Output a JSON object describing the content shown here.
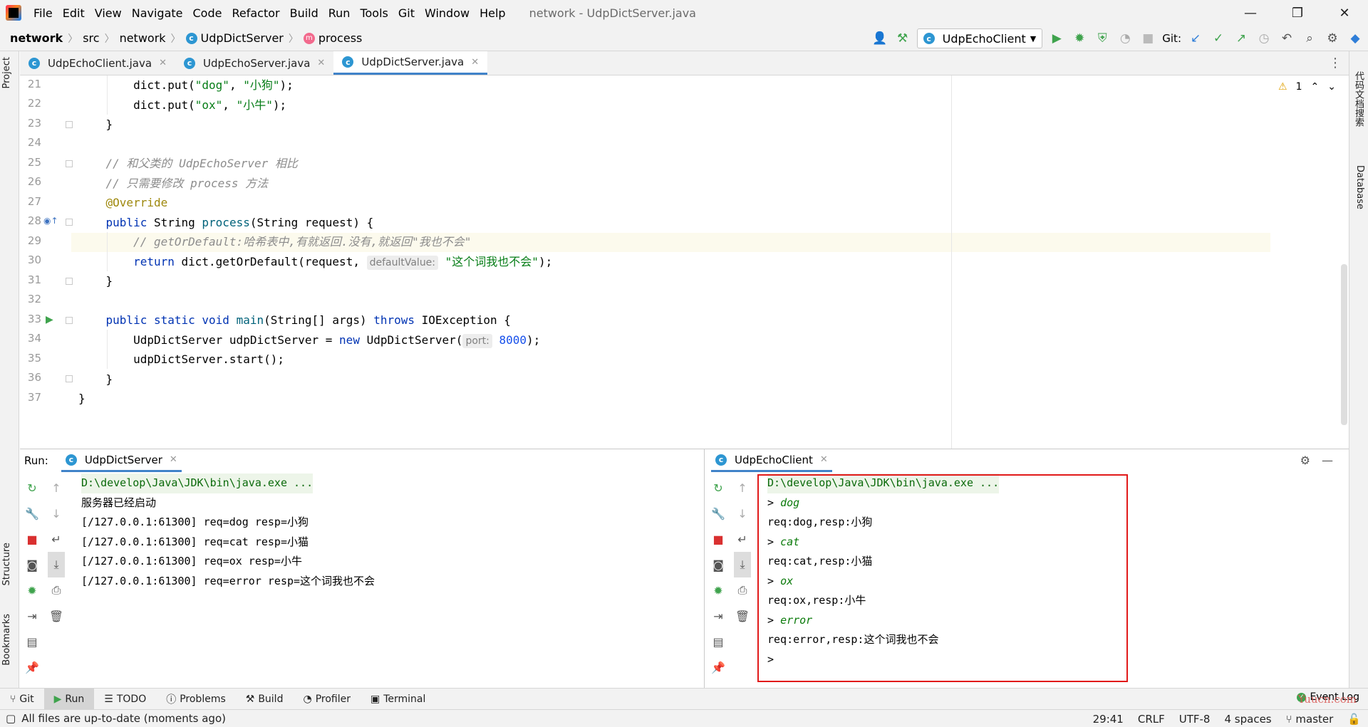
{
  "window": {
    "title": "network - UdpDictServer.java",
    "menu": [
      "File",
      "Edit",
      "View",
      "Navigate",
      "Code",
      "Refactor",
      "Build",
      "Run",
      "Tools",
      "Git",
      "Window",
      "Help"
    ]
  },
  "breadcrumb": [
    "network",
    "src",
    "network",
    "UdpDictServer",
    "process"
  ],
  "toolbar": {
    "run_config": "UdpEchoClient",
    "git_label": "Git:"
  },
  "left_strip": {
    "project": "Project",
    "structure": "Structure",
    "bookmarks": "Bookmarks"
  },
  "right_strip": {
    "code_search": "代码文档搜索",
    "database": "Database"
  },
  "tabs": [
    {
      "label": "UdpEchoClient.java",
      "active": false
    },
    {
      "label": "UdpEchoServer.java",
      "active": false
    },
    {
      "label": "UdpDictServer.java",
      "active": true
    }
  ],
  "editor": {
    "warning_count": "1",
    "line_numbers": [
      "21",
      "22",
      "23",
      "24",
      "25",
      "26",
      "27",
      "28",
      "29",
      "30",
      "31",
      "32",
      "33",
      "34",
      "35",
      "36",
      "37"
    ],
    "lines": {
      "l21": {
        "a": "        dict.put(",
        "s1": "\"dog\"",
        "b": ", ",
        "s2": "\"小狗\"",
        "c": ");"
      },
      "l22": {
        "a": "        dict.put(",
        "s1": "\"ox\"",
        "b": ", ",
        "s2": "\"小牛\"",
        "c": ");"
      },
      "l23": "    }",
      "l25": "    // 和父类的 UdpEchoServer 相比",
      "l26": "    // 只需要修改 process 方法",
      "l27": "    @Override",
      "l28": {
        "kw": "    public ",
        "type": "String ",
        "name": "process",
        "args": "(String request) {"
      },
      "l29": "        // getOrDefault:哈希表中,有就返回.没有,就返回\"我也不会\"",
      "l30": {
        "kw": "        return ",
        "a": "dict.getOrDefault(request, ",
        "hint": "defaultValue:",
        "s": "\"这个词我也不会\"",
        "c": ");"
      },
      "l31": "    }",
      "l33": {
        "kw": "    public static void ",
        "name": "main",
        "a": "(String[] args) ",
        "kw2": "throws ",
        "b": "IOException {"
      },
      "l34": {
        "a": "        UdpDictServer udpDictServer = ",
        "kw": "new ",
        "b": "UdpDictServer(",
        "hint": "port:",
        "n": "8000",
        "c": ");"
      },
      "l35": "        udpDictServer.start();",
      "l36": "    }",
      "l37": "}"
    }
  },
  "run_panel": {
    "label": "Run:",
    "server_tab": "UdpDictServer",
    "client_tab": "UdpEchoClient",
    "server_output": [
      "D:\\develop\\Java\\JDK\\bin\\java.exe ...",
      "服务器已经启动",
      "[/127.0.0.1:61300] req=dog resp=小狗",
      "[/127.0.0.1:61300] req=cat resp=小猫",
      "[/127.0.0.1:61300] req=ox resp=小牛",
      "[/127.0.0.1:61300] req=error resp=这个词我也不会"
    ],
    "client_output": [
      {
        "text": "D:\\develop\\Java\\JDK\\bin\\java.exe ...",
        "kind": "cmd"
      },
      {
        "prompt": "> ",
        "text": "dog",
        "kind": "input"
      },
      {
        "text": "req:dog,resp:小狗",
        "kind": "out"
      },
      {
        "prompt": "> ",
        "text": "cat",
        "kind": "input"
      },
      {
        "text": "req:cat,resp:小猫",
        "kind": "out"
      },
      {
        "prompt": "> ",
        "text": "ox",
        "kind": "input"
      },
      {
        "text": "req:ox,resp:小牛",
        "kind": "out"
      },
      {
        "prompt": "> ",
        "text": "error",
        "kind": "input"
      },
      {
        "text": "req:error,resp:这个词我也不会",
        "kind": "out"
      },
      {
        "prompt": ">",
        "text": "",
        "kind": "input"
      }
    ]
  },
  "bottom_tools": [
    "Git",
    "Run",
    "TODO",
    "Problems",
    "Build",
    "Profiler",
    "Terminal"
  ],
  "event_log": "Event Log",
  "status": {
    "message": "All files are up-to-date (moments ago)",
    "position": "29:41",
    "line_sep": "CRLF",
    "encoding": "UTF-8",
    "indent": "4 spaces",
    "branch": "master"
  },
  "watermark": "Yuucn.com",
  "colors": {
    "accent": "#4083c9",
    "highlight_box": "#e11a1a",
    "run_green": "#3fa34d"
  }
}
